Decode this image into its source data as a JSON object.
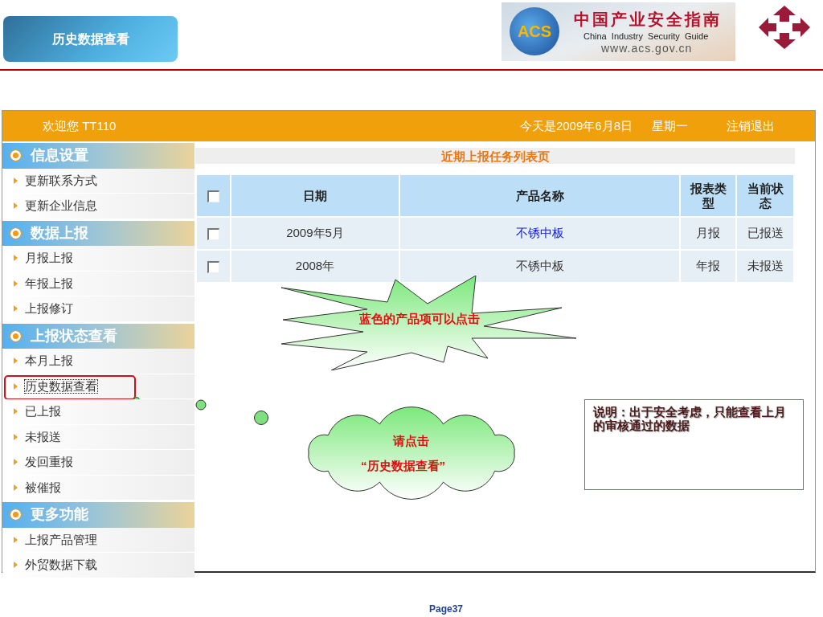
{
  "slide": {
    "title_button": "历史数据查看",
    "logo": {
      "badge": "ACS",
      "title": "中国产业安全指南",
      "subtitle": "China  Industry  Security  Guide",
      "url": "www.acs.gov.cn"
    },
    "page": "Page37"
  },
  "app": {
    "welcome": "欢迎您  TT110",
    "date": "今天是2009年6月8日",
    "weekday": "星期一",
    "logout": "注销退出",
    "sidebar": [
      {
        "title": "信息设置",
        "items": [
          {
            "label": "更新联系方式",
            "selected": false
          },
          {
            "label": "更新企业信息",
            "selected": false
          }
        ]
      },
      {
        "title": "数据上报",
        "items": [
          {
            "label": "月报上报",
            "selected": false
          },
          {
            "label": "年报上报",
            "selected": false
          },
          {
            "label": "上报修订",
            "selected": false
          }
        ]
      },
      {
        "title": "上报状态查看",
        "items": [
          {
            "label": "本月上报",
            "selected": false
          },
          {
            "label": "历史数据查看",
            "selected": true
          },
          {
            "label": "已上报",
            "selected": false
          },
          {
            "label": "未报送",
            "selected": false
          },
          {
            "label": "发回重报",
            "selected": false
          },
          {
            "label": "被催报",
            "selected": false
          }
        ]
      },
      {
        "title": "更多功能",
        "items": [
          {
            "label": "上报产品管理",
            "selected": false
          },
          {
            "label": "外贸数据下载",
            "selected": false
          }
        ]
      }
    ],
    "list_title": "近期上报任务列表页",
    "table": {
      "header_checked": false,
      "columns": [
        "日期",
        "产品名称",
        "报表类型",
        "当前状态"
      ],
      "rows": [
        {
          "checked": false,
          "date": "2009年5月",
          "product": "不锈中板",
          "link": true,
          "type": "月报",
          "status": "已报送"
        },
        {
          "checked": false,
          "date": "2008年",
          "product": "不锈中板",
          "link": false,
          "type": "年报",
          "status": "未报送"
        }
      ]
    }
  },
  "annotations": {
    "starburst": "蓝色的产品项可以点击",
    "cloud": [
      "请点击",
      "“历史数据查看”"
    ],
    "note": "说明：出于安全考虑，只能查看上月的审核通过的数据"
  }
}
